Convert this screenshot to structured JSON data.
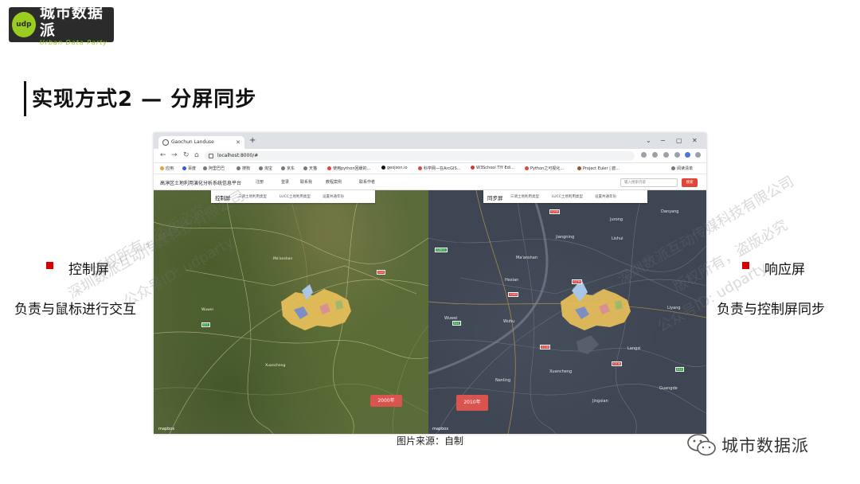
{
  "logo": {
    "badge_text": "udp",
    "name_cn": "城市数据派",
    "name_en": "Urban Data Party"
  },
  "slide": {
    "title": "实现方式2 — 分屏同步",
    "left_label": "控制屏",
    "left_desc": "负责与鼠标进行交互",
    "right_label": "响应屏",
    "right_desc": "负责与控制屏同步",
    "caption": "图片来源：自制",
    "footer_brand": "城市数据派"
  },
  "watermarks": [
    "深圳数派互动传媒科技有限公司",
    "版权所有，盗版必究",
    "公众号ID: udparty"
  ],
  "browser": {
    "tab_title": "Gaochun Landuse",
    "url": "localhost:8000/#",
    "bookmarks": [
      "应用",
      "百度",
      "阿里巴巴",
      "搜狗",
      "淘宝",
      "京东",
      "天猫",
      "使用python回缓的...",
      "geojson.io",
      "科学网—在ArcGIS...",
      "W3School TIY Edi...",
      "Python之可视化...",
      "Project Euler | 欧...",
      "阅读清单"
    ]
  },
  "app": {
    "title": "高淳区土地利用演化分析系统信息平台",
    "nav": [
      "注册",
      "登录",
      "联系我",
      "教程案例",
      "联系作者"
    ],
    "search_placeholder": "输入搜索内容",
    "search_button": "搜索"
  },
  "left_map": {
    "panel_title": "控制屏",
    "panel_items": [
      "三调土地利用类型",
      "LUCC土地利用类型",
      "设置共通年份"
    ],
    "year": "2000年",
    "attribution": "mapbox"
  },
  "right_map": {
    "panel_title": "同步屏",
    "panel_items": [
      "三调土地利用类型",
      "LUCC土地利用类型",
      "设置共通年份"
    ],
    "year": "2010年",
    "attribution": "mapbox",
    "cities": [
      "Danyang",
      "Ma'anshan",
      "Jiangning",
      "Hexian",
      "Wuhu",
      "Xuancheng",
      "Lishui",
      "Liyang",
      "Jurong",
      "Wuwei",
      "Langxi",
      "Guangde",
      "Nanling",
      "Jingxian"
    ]
  },
  "colors": {
    "accent_red": "#d60000",
    "logo_green": "#9acd1f",
    "year_badge": "#d9534f"
  }
}
